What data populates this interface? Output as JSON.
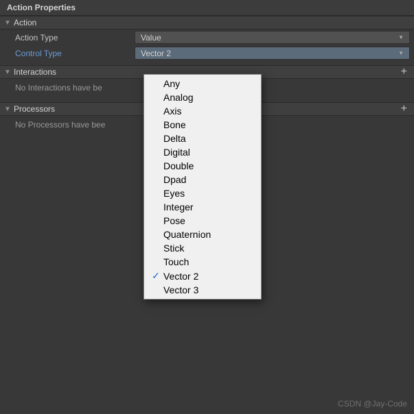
{
  "panel_title": "Action Properties",
  "sections": {
    "action": {
      "title": "Action",
      "action_type_label": "Action Type",
      "action_type_value": "Value",
      "control_type_label": "Control Type",
      "control_type_value": "Vector 2"
    },
    "interactions": {
      "title": "Interactions",
      "empty": "No Interactions have be"
    },
    "processors": {
      "title": "Processors",
      "empty": "No Processors have bee"
    }
  },
  "control_type_options": [
    "Any",
    "Analog",
    "Axis",
    "Bone",
    "Delta",
    "Digital",
    "Double",
    "Dpad",
    "Eyes",
    "Integer",
    "Pose",
    "Quaternion",
    "Stick",
    "Touch",
    "Vector 2",
    "Vector 3"
  ],
  "control_type_selected": "Vector 2",
  "watermark": "CSDN @Jay-Code"
}
